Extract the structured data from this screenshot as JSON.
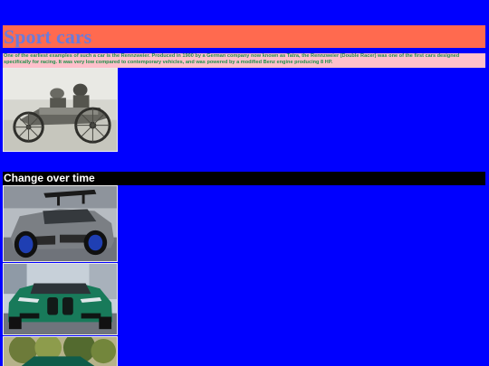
{
  "page": {
    "title": "Sport cars",
    "intro": "One of the earliest examples of such a car is the Rennzweier. Produced in 1900 by a German company now known as Tatra, the Rennzweier (Double Racer) was one of the first cars designed specifically for racing. It was very low compared to contemporary vehicles, and was powered by a modified Benz engine producing 8 HP.",
    "section_heading": "Change over time"
  },
  "colors": {
    "background": "#0000ff",
    "title_background": "#ff6a4f",
    "title_text": "#6c7bd9",
    "intro_background": "#ffc0cb",
    "intro_text": "#1f8f4a",
    "section_background": "#000000",
    "section_text": "#ffffff"
  },
  "images": [
    {
      "name": "vintage-race-car-photo"
    },
    {
      "name": "grey-widebody-sports-car-photo"
    },
    {
      "name": "green-sports-car-photo"
    },
    {
      "name": "partial-car-photo"
    }
  ]
}
